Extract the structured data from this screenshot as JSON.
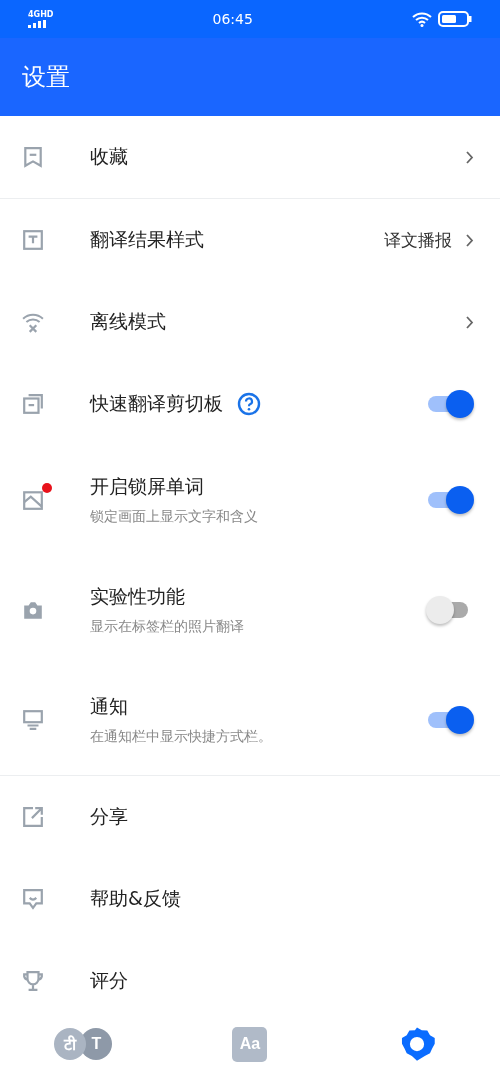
{
  "status_bar": {
    "network": "4GHD",
    "time": "06:45"
  },
  "header": {
    "title": "设置"
  },
  "sections": [
    {
      "items": [
        {
          "kind": "link",
          "label": "收藏"
        }
      ]
    },
    {
      "items": [
        {
          "kind": "link",
          "label": "翻译结果样式",
          "value": "译文播报"
        },
        {
          "kind": "link",
          "label": "离线模式"
        },
        {
          "kind": "toggle",
          "label": "快速翻译剪切板",
          "on": true,
          "help": true
        },
        {
          "kind": "toggle",
          "label": "开启锁屏单词",
          "subtitle": "锁定画面上显示文字和含义",
          "on": true,
          "badge": true
        },
        {
          "kind": "toggle",
          "label": "实验性功能",
          "subtitle": "显示在标签栏的照片翻译",
          "on": false
        },
        {
          "kind": "toggle",
          "label": "通知",
          "subtitle": "在通知栏中显示快捷方式栏。",
          "on": true
        }
      ]
    },
    {
      "items": [
        {
          "kind": "plain",
          "label": "分享"
        },
        {
          "kind": "plain",
          "label": "帮助&反馈"
        },
        {
          "kind": "plain",
          "label": "评分"
        }
      ]
    }
  ],
  "bottom_nav": [
    {
      "kind": "translate",
      "glyphs": [
        "टी",
        "T"
      ],
      "selected": false
    },
    {
      "kind": "dictionary",
      "glyphs": [
        "Aa"
      ],
      "selected": false
    },
    {
      "kind": "settings",
      "selected": true
    }
  ]
}
